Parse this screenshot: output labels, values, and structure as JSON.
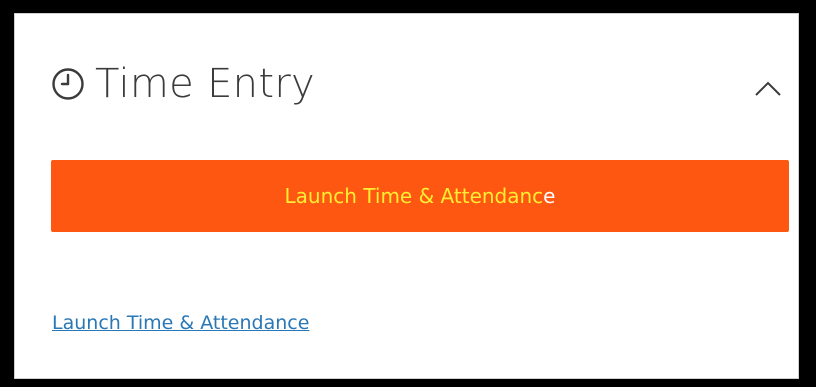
{
  "panel": {
    "title": "Time Entry",
    "title_icon": "clock-icon",
    "toggle_icon": "chevron-up-icon"
  },
  "launch_button": {
    "label_main": "Launch Time & Attendanc",
    "label_tail": "e",
    "background_color": "#fe5711",
    "text_color": "#ffee33"
  },
  "launch_link": {
    "label": "Launch Time & Attendance",
    "color": "#2a77b6"
  }
}
